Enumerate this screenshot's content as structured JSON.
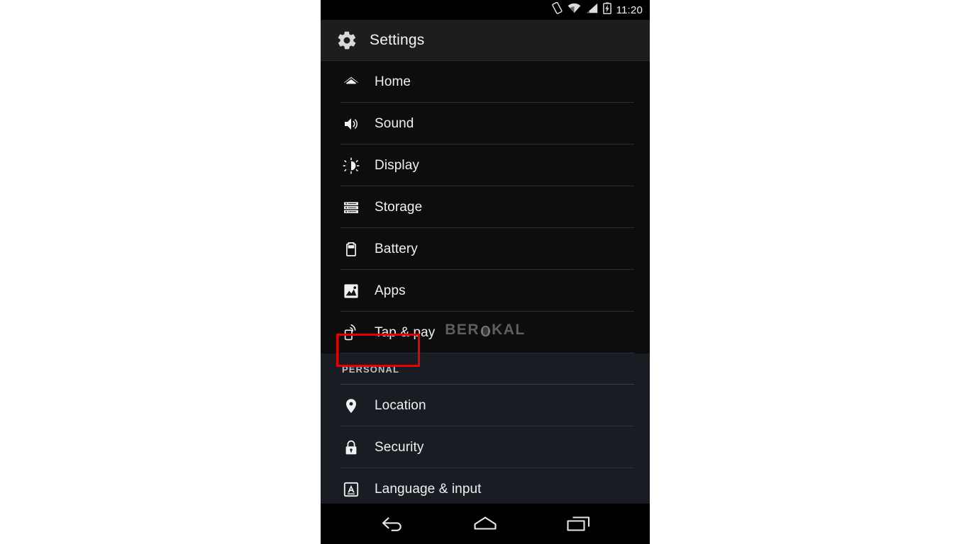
{
  "screen": {
    "device_frame_bg": "#ffffff",
    "screen_bg": "#0b0b0c"
  },
  "status_bar": {
    "time": "11:20",
    "icons": [
      {
        "name": "rotation-lock-icon",
        "label": "Auto-rotate"
      },
      {
        "name": "wifi-icon",
        "label": "Wi-Fi"
      },
      {
        "name": "cellular-signal-icon",
        "label": "Signal"
      },
      {
        "name": "battery-charging-icon",
        "label": "Battery charging"
      }
    ]
  },
  "action_bar": {
    "title": "Settings",
    "icon": "gear-icon"
  },
  "list": {
    "groups": [
      {
        "id": "system",
        "header": null,
        "items": [
          {
            "id": "home",
            "label": "Home",
            "icon": "home-icon"
          },
          {
            "id": "sound",
            "label": "Sound",
            "icon": "sound-icon"
          },
          {
            "id": "display",
            "label": "Display",
            "icon": "display-brightness-icon"
          },
          {
            "id": "storage",
            "label": "Storage",
            "icon": "storage-icon"
          },
          {
            "id": "battery",
            "label": "Battery",
            "icon": "battery-icon"
          },
          {
            "id": "apps",
            "label": "Apps",
            "icon": "apps-image-icon",
            "highlighted": true
          },
          {
            "id": "tap_pay",
            "label": "Tap & pay",
            "icon": "tap-and-pay-icon"
          }
        ]
      },
      {
        "id": "personal",
        "header": "PERSONAL",
        "items": [
          {
            "id": "location",
            "label": "Location",
            "icon": "location-pin-icon"
          },
          {
            "id": "security",
            "label": "Security",
            "icon": "lock-icon"
          },
          {
            "id": "language",
            "label": "Language & input",
            "icon": "language-input-icon"
          }
        ]
      }
    ]
  },
  "annotation": {
    "target": "apps",
    "shape": "rectangle",
    "color": "#e60000"
  },
  "watermark": {
    "text_before": "BER",
    "text_after": "KAL",
    "full_text": "BEROKAL",
    "color": "#6d6d6d"
  },
  "nav_bar": {
    "buttons": [
      {
        "id": "back",
        "name": "back-button",
        "label": "Back"
      },
      {
        "id": "home",
        "name": "home-button",
        "label": "Home"
      },
      {
        "id": "recents",
        "name": "recents-button",
        "label": "Recent apps"
      }
    ]
  }
}
